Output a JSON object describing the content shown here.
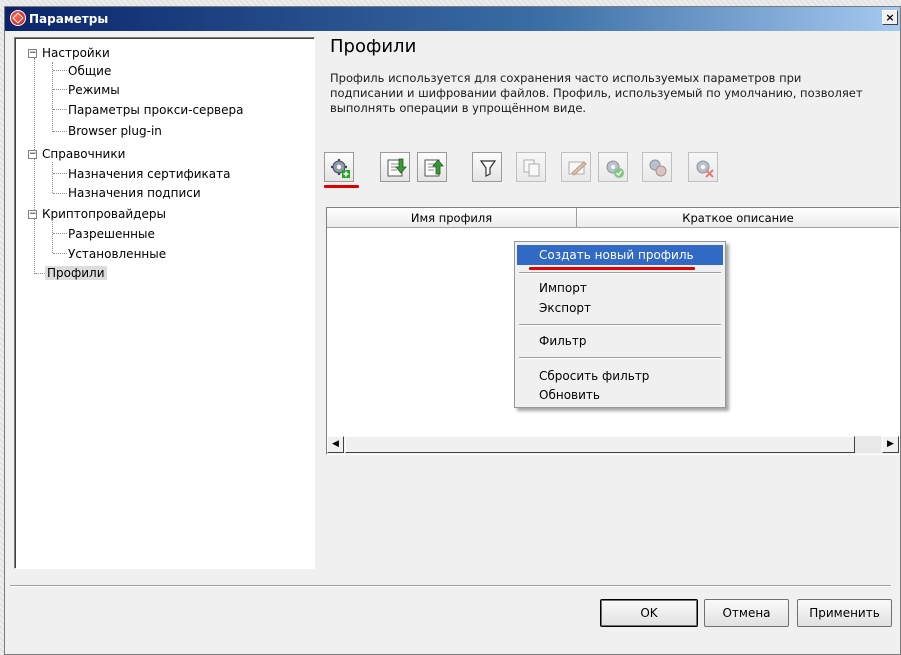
{
  "window": {
    "title": "Параметры",
    "close_glyph": "×"
  },
  "tree": {
    "nodes": [
      {
        "label": "Настройки",
        "expander": "−"
      },
      {
        "label": "Общие"
      },
      {
        "label": "Режимы"
      },
      {
        "label": "Параметры прокси-сервера"
      },
      {
        "label": "Browser plug-in"
      },
      {
        "label": "Справочники",
        "expander": "−"
      },
      {
        "label": "Назначения сертификата"
      },
      {
        "label": "Назначения подписи"
      },
      {
        "label": "Криптопровайдеры",
        "expander": "−"
      },
      {
        "label": "Разрешенные"
      },
      {
        "label": "Установленные"
      },
      {
        "label": "Профили",
        "selected": true
      }
    ]
  },
  "main": {
    "heading": "Профили",
    "description_lines": [
      "Профиль используется для сохранения часто используемых параметров при",
      "подписании и шифровании файлов. Профиль, используемый по умолчанию, позволяет",
      "выполнять операции в упрощённом виде."
    ]
  },
  "toolbar": {
    "buttons": [
      {
        "icon": "gear-add-icon",
        "enabled": true
      },
      {
        "icon": "import-icon",
        "enabled": true
      },
      {
        "icon": "export-icon",
        "enabled": true
      },
      {
        "icon": "filter-icon",
        "enabled": true
      },
      {
        "icon": "copy-icon",
        "enabled": false
      },
      {
        "icon": "edit-icon",
        "enabled": false
      },
      {
        "icon": "gear-check-icon",
        "enabled": false
      },
      {
        "icon": "gear-multi-icon",
        "enabled": false
      },
      {
        "icon": "gear-delete-icon",
        "enabled": false
      }
    ]
  },
  "list": {
    "columns": [
      "Имя профиля",
      "Краткое описание"
    ],
    "scroll": {
      "left_glyph": "◀",
      "right_glyph": "▶"
    }
  },
  "context_menu": {
    "items": [
      {
        "label": "Создать новый профиль",
        "highlighted": true
      },
      {
        "label": "Импорт"
      },
      {
        "label": "Экспорт"
      },
      {
        "label": "Фильтр"
      },
      {
        "label": "Сбросить фильтр"
      },
      {
        "label": "Обновить"
      }
    ]
  },
  "buttons": {
    "ok": "OK",
    "cancel": "Отмена",
    "apply": "Применить"
  },
  "colors": {
    "highlight": "#316ac5",
    "annotation_red": "#e00000",
    "title_bar": "#0a246a"
  }
}
